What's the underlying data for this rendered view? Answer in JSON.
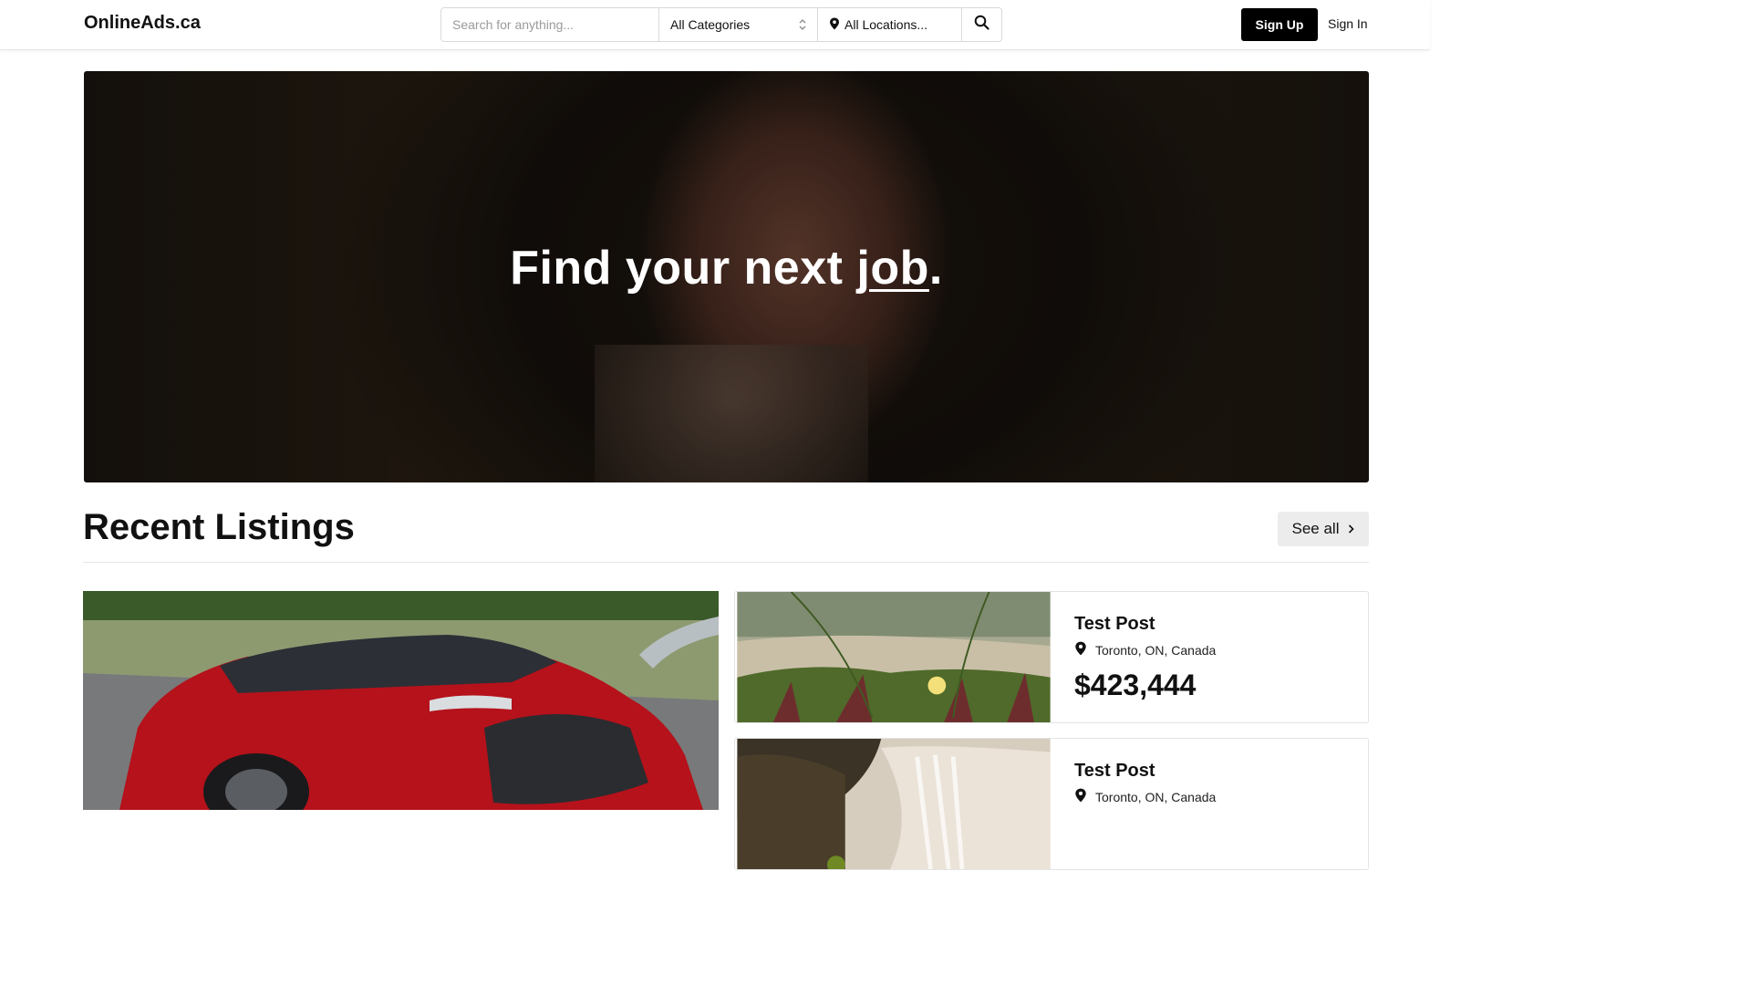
{
  "header": {
    "brand": "OnlineAds.ca",
    "search_placeholder": "Search for anything...",
    "category": "All Categories",
    "location": "All Locations...",
    "signup_label": "Sign Up",
    "signin_label": "Sign In"
  },
  "hero": {
    "title_prefix": "Find your next ",
    "title_keyword": "job",
    "title_suffix": "."
  },
  "recent": {
    "title": "Recent Listings",
    "see_all_label": "See all",
    "featured_image": "red-sedan-photo",
    "listings": [
      {
        "title": "Test Post",
        "location": "Toronto, ON, Canada",
        "price": "$423,444",
        "image": "flower-dune-photo"
      },
      {
        "title": "Test Post",
        "location": "Toronto, ON, Canada",
        "price": "",
        "image": "waterfall-photo"
      }
    ]
  },
  "icons": {
    "location": "map-pin-icon",
    "search": "magnifier-icon",
    "see_all": "chevron-right-icon",
    "category": "up-down-chevron-icon"
  },
  "colors": {
    "primary_button": "#000000",
    "see_all_bg": "#ececec",
    "border": "#d9d9d9"
  }
}
